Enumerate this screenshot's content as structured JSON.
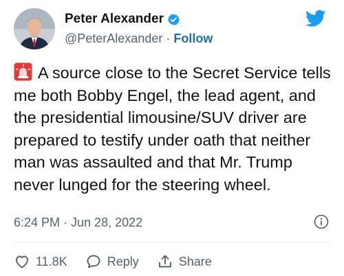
{
  "author": {
    "name": "Peter Alexander",
    "handle": "@PeterAlexander",
    "separator": "·",
    "follow_label": "Follow",
    "verified": true
  },
  "tweet": {
    "emoji": "rotating-light",
    "text": "A source close to the Secret Service tells me both Bobby Engel, the lead agent, and the presidential limousine/SUV driver are prepared to testify under oath that neither man was assaulted and that Mr. Trump never lunged for the steering wheel.",
    "timestamp": "6:24 PM · Jun 28, 2022"
  },
  "actions": {
    "like_count": "11.8K",
    "reply_label": "Reply",
    "share_label": "Share"
  },
  "colors": {
    "brand_blue": "#1d9bf0",
    "follow_link": "#1d6fa5",
    "muted_text": "#536471",
    "text": "#0f1419"
  },
  "icons": [
    "avatar-photo",
    "verified-badge-icon",
    "twitter-bird-icon",
    "rotating-light-icon",
    "info-icon",
    "heart-icon",
    "reply-bubble-icon",
    "share-icon"
  ]
}
